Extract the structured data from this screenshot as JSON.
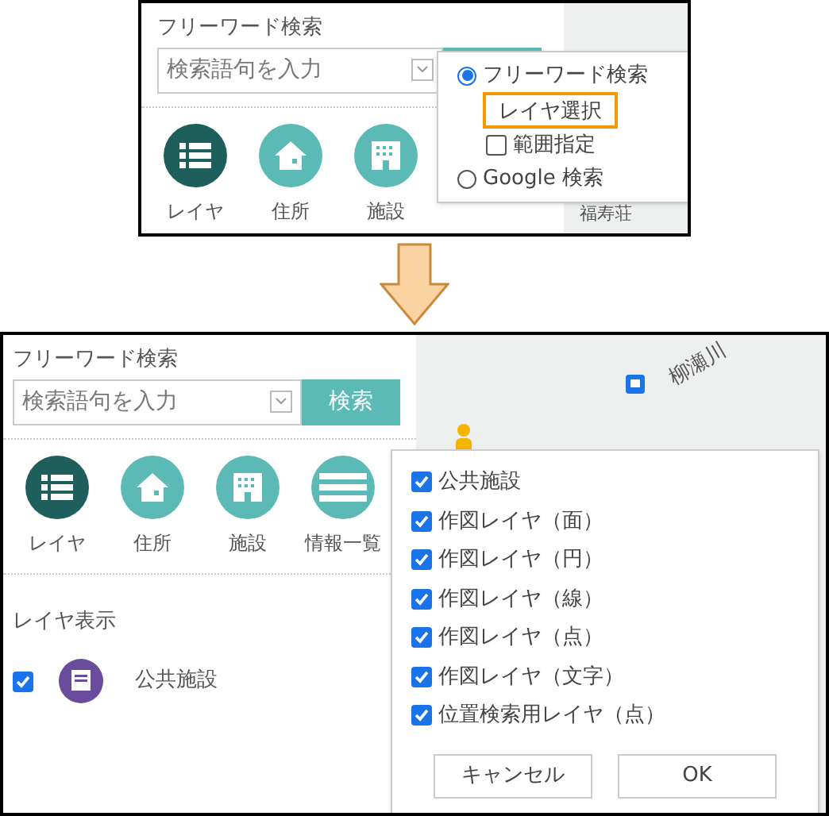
{
  "before": {
    "search": {
      "label": "フリーワード検索",
      "placeholder": "検索語句を入力"
    },
    "tools": [
      {
        "label": "レイヤ",
        "selected": true
      },
      {
        "label": "住所",
        "selected": false
      },
      {
        "label": "施設",
        "selected": false
      }
    ],
    "map_labels": [
      "福寿荘"
    ],
    "mode_menu": [
      {
        "kind": "radio",
        "label": "フリーワード検索",
        "selected": true,
        "highlighted": false
      },
      {
        "kind": "plain",
        "label": "レイヤ選択",
        "highlighted": true
      },
      {
        "kind": "checkbox",
        "label": "範囲指定",
        "checked": false,
        "highlighted": false
      },
      {
        "kind": "radio",
        "label": "Google 検索",
        "selected": false,
        "highlighted": false
      }
    ]
  },
  "after": {
    "search": {
      "label": "フリーワード検索",
      "placeholder": "検索語句を入力",
      "button": "検索"
    },
    "tools": [
      {
        "label": "レイヤ",
        "selected": true
      },
      {
        "label": "住所",
        "selected": false
      },
      {
        "label": "施設",
        "selected": false
      },
      {
        "label": "情報一覧",
        "selected": false
      }
    ],
    "map_labels": [
      "柳瀬川"
    ],
    "layer_panel": {
      "title": "レイヤ表示",
      "layers": [
        {
          "label": "公共施設",
          "checked": true
        }
      ]
    },
    "layer_dialog": {
      "items": [
        {
          "label": "公共施設",
          "checked": true
        },
        {
          "label": "作図レイヤ（面）",
          "checked": true
        },
        {
          "label": "作図レイヤ（円）",
          "checked": true
        },
        {
          "label": "作図レイヤ（線）",
          "checked": true
        },
        {
          "label": "作図レイヤ（点）",
          "checked": true
        },
        {
          "label": "作図レイヤ（文字）",
          "checked": true
        },
        {
          "label": "位置検索用レイヤ（点）",
          "checked": true
        }
      ],
      "buttons": [
        "キャンセル",
        "OK"
      ]
    }
  }
}
